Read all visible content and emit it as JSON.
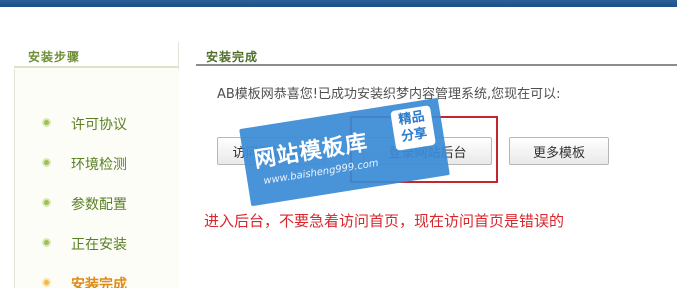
{
  "sidebar": {
    "title": "安装步骤",
    "steps": [
      {
        "label": "许可协议",
        "state": "done"
      },
      {
        "label": "环境检测",
        "state": "done"
      },
      {
        "label": "参数配置",
        "state": "done"
      },
      {
        "label": "正在安装",
        "state": "done"
      },
      {
        "label": "安装完成",
        "state": "current"
      }
    ]
  },
  "main": {
    "title": "安装完成",
    "message": "AB模板网恭喜您!已成功安装织梦内容管理系统,您现在可以:",
    "buttons": {
      "visit": "访问网站首页",
      "admin": "登录网站后台",
      "more": "更多模板"
    },
    "note": "进入后台，不要急着访问首页，现在访问首页是错误的"
  },
  "watermark": {
    "title": "网站模板库",
    "badge_line1": "精品",
    "badge_line2": "分享",
    "url": "www.baisheng999.com"
  },
  "colors": {
    "topbar": "#1f4f86",
    "sidebar_accent": "#6f8f37",
    "current_step": "#e08a14",
    "note_red": "#d9262c",
    "watermark_blue": "#3a8bd6"
  }
}
